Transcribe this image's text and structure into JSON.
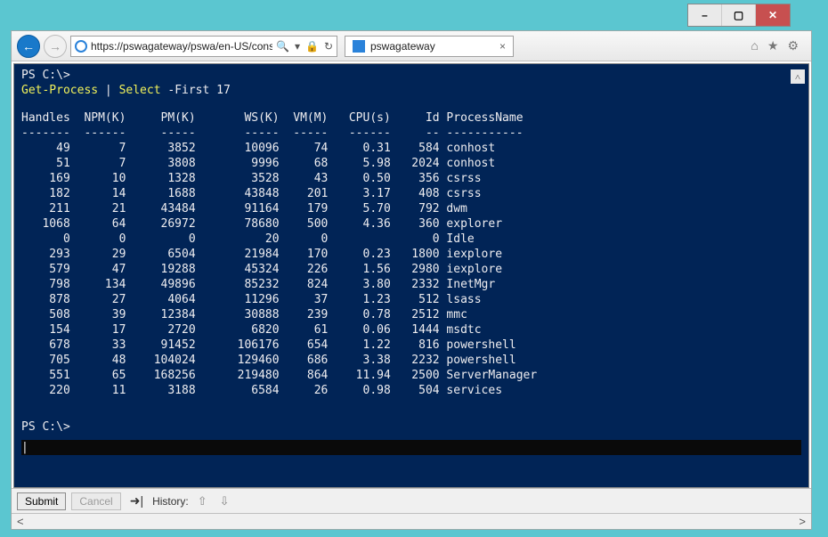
{
  "window": {
    "minimize": "–",
    "maximize": "▢",
    "close": "✕"
  },
  "nav": {
    "back": "←",
    "forward": "→",
    "url": "https://pswagateway/pswa/en-US/conso",
    "search_glyph": "🔍",
    "dropdown_glyph": "▾",
    "lock_glyph": "🔒",
    "refresh_glyph": "↻"
  },
  "tab": {
    "title": "pswagateway",
    "close": "×"
  },
  "tools": {
    "home": "⌂",
    "star": "★",
    "gear": "⚙"
  },
  "console": {
    "prompt1_prefix": "PS C:\\>",
    "command_cmdlet": "Get-Process",
    "command_pipe": " | ",
    "command_select": "Select",
    "command_param": " -First ",
    "command_arg": "17",
    "headers": [
      "Handles",
      "NPM(K)",
      "PM(K)",
      "WS(K)",
      "VM(M)",
      "CPU(s)",
      "Id",
      "ProcessName"
    ],
    "rows": [
      {
        "Handles": "49",
        "NPM": "7",
        "PM": "3852",
        "WS": "10096",
        "VM": "74",
        "CPU": "0.31",
        "Id": "584",
        "Name": "conhost"
      },
      {
        "Handles": "51",
        "NPM": "7",
        "PM": "3808",
        "WS": "9996",
        "VM": "68",
        "CPU": "5.98",
        "Id": "2024",
        "Name": "conhost"
      },
      {
        "Handles": "169",
        "NPM": "10",
        "PM": "1328",
        "WS": "3528",
        "VM": "43",
        "CPU": "0.50",
        "Id": "356",
        "Name": "csrss"
      },
      {
        "Handles": "182",
        "NPM": "14",
        "PM": "1688",
        "WS": "43848",
        "VM": "201",
        "CPU": "3.17",
        "Id": "408",
        "Name": "csrss"
      },
      {
        "Handles": "211",
        "NPM": "21",
        "PM": "43484",
        "WS": "91164",
        "VM": "179",
        "CPU": "5.70",
        "Id": "792",
        "Name": "dwm"
      },
      {
        "Handles": "1068",
        "NPM": "64",
        "PM": "26972",
        "WS": "78680",
        "VM": "500",
        "CPU": "4.36",
        "Id": "360",
        "Name": "explorer"
      },
      {
        "Handles": "0",
        "NPM": "0",
        "PM": "0",
        "WS": "20",
        "VM": "0",
        "CPU": "",
        "Id": "0",
        "Name": "Idle"
      },
      {
        "Handles": "293",
        "NPM": "29",
        "PM": "6504",
        "WS": "21984",
        "VM": "170",
        "CPU": "0.23",
        "Id": "1800",
        "Name": "iexplore"
      },
      {
        "Handles": "579",
        "NPM": "47",
        "PM": "19288",
        "WS": "45324",
        "VM": "226",
        "CPU": "1.56",
        "Id": "2980",
        "Name": "iexplore"
      },
      {
        "Handles": "798",
        "NPM": "134",
        "PM": "49896",
        "WS": "85232",
        "VM": "824",
        "CPU": "3.80",
        "Id": "2332",
        "Name": "InetMgr"
      },
      {
        "Handles": "878",
        "NPM": "27",
        "PM": "4064",
        "WS": "11296",
        "VM": "37",
        "CPU": "1.23",
        "Id": "512",
        "Name": "lsass"
      },
      {
        "Handles": "508",
        "NPM": "39",
        "PM": "12384",
        "WS": "30888",
        "VM": "239",
        "CPU": "0.78",
        "Id": "2512",
        "Name": "mmc"
      },
      {
        "Handles": "154",
        "NPM": "17",
        "PM": "2720",
        "WS": "6820",
        "VM": "61",
        "CPU": "0.06",
        "Id": "1444",
        "Name": "msdtc"
      },
      {
        "Handles": "678",
        "NPM": "33",
        "PM": "91452",
        "WS": "106176",
        "VM": "654",
        "CPU": "1.22",
        "Id": "816",
        "Name": "powershell"
      },
      {
        "Handles": "705",
        "NPM": "48",
        "PM": "104024",
        "WS": "129460",
        "VM": "686",
        "CPU": "3.38",
        "Id": "2232",
        "Name": "powershell"
      },
      {
        "Handles": "551",
        "NPM": "65",
        "PM": "168256",
        "WS": "219480",
        "VM": "864",
        "CPU": "11.94",
        "Id": "2500",
        "Name": "ServerManager"
      },
      {
        "Handles": "220",
        "NPM": "11",
        "PM": "3188",
        "WS": "6584",
        "VM": "26",
        "CPU": "0.98",
        "Id": "504",
        "Name": "services"
      }
    ],
    "prompt2": "PS C:\\>",
    "cursor": "|"
  },
  "bottom": {
    "submit": "Submit",
    "cancel": "Cancel",
    "tab_sym": "➜|",
    "history_label": "History:",
    "up": "⇧",
    "down": "⇩"
  },
  "hscroll": {
    "left": "<",
    "right": ">"
  },
  "scroll_up_glyph": "˄"
}
